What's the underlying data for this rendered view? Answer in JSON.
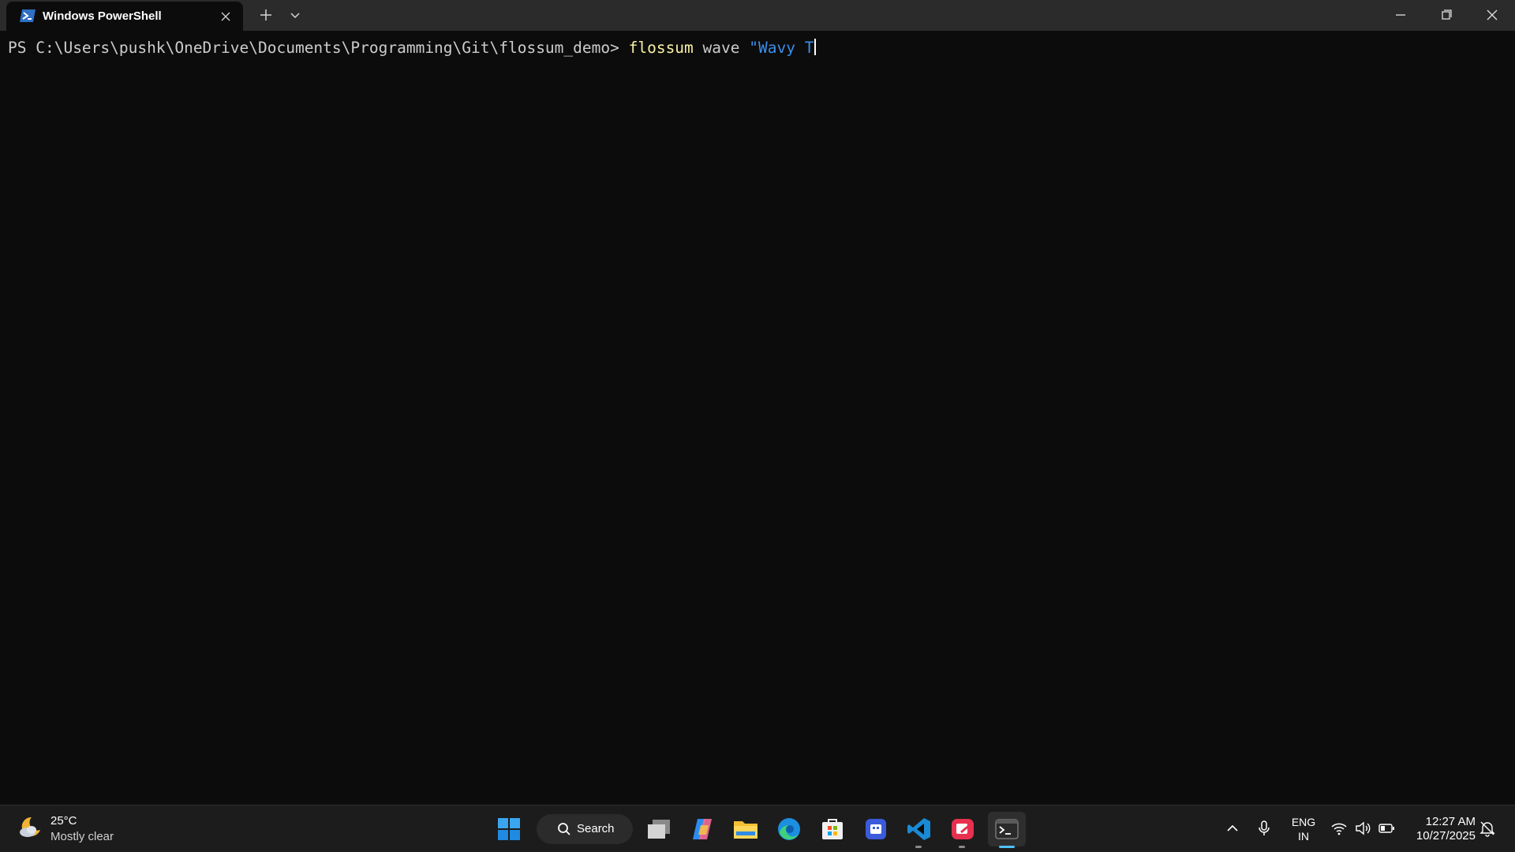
{
  "window": {
    "tab_title": "Windows PowerShell",
    "tab_icon": "powershell-icon"
  },
  "terminal": {
    "prompt_prefix": "PS ",
    "prompt_path": "C:\\Users\\pushk\\OneDrive\\Documents\\Programming\\Git\\flossum_demo",
    "prompt_symbol": "> ",
    "command": "flossum",
    "argument": " wave ",
    "string_arg": "\"Wavy T"
  },
  "taskbar": {
    "weather": {
      "temperature": "25°C",
      "condition": "Mostly clear",
      "icon": "moon-cloud-icon"
    },
    "search_label": "Search",
    "apps": [
      {
        "name": "start",
        "icon": "windows-logo-icon"
      },
      {
        "name": "task-view",
        "icon": "task-view-icon"
      },
      {
        "name": "copilot",
        "icon": "copilot-icon"
      },
      {
        "name": "file-explorer",
        "icon": "folder-icon"
      },
      {
        "name": "edge",
        "icon": "edge-icon"
      },
      {
        "name": "store",
        "icon": "store-icon"
      },
      {
        "name": "app-blue",
        "icon": "app-icon"
      },
      {
        "name": "vscode",
        "icon": "vscode-icon"
      },
      {
        "name": "app-red",
        "icon": "app-icon"
      },
      {
        "name": "terminal",
        "icon": "terminal-icon"
      }
    ],
    "language_line1": "ENG",
    "language_line2": "IN",
    "time": "12:27 AM",
    "date": "10/27/2025"
  },
  "colors": {
    "terminal_bg": "#0c0c0c",
    "command_yellow": "#f9f1a5",
    "string_blue": "#3b8eea",
    "taskbar_bg": "#1c1c1c",
    "accent": "#4cc2ff"
  }
}
